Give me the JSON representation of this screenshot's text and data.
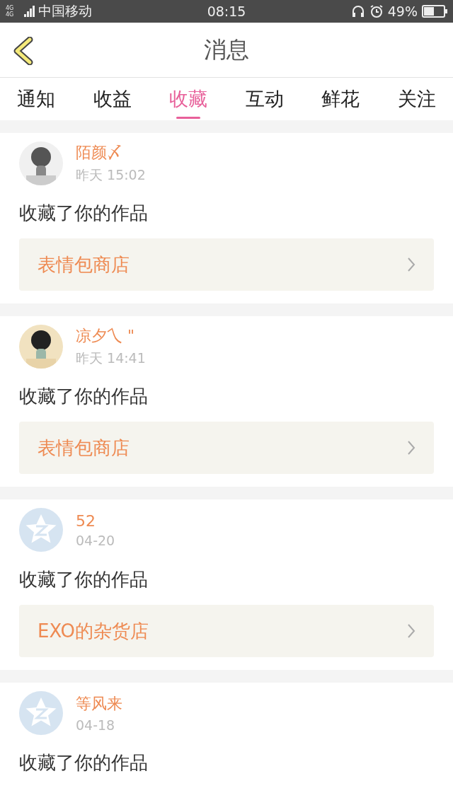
{
  "status_bar": {
    "network": "4G 4G",
    "carrier": "中国移动",
    "time": "08:15",
    "battery": "49%"
  },
  "header": {
    "title": "消息"
  },
  "tabs": [
    {
      "label": "通知",
      "selected": false
    },
    {
      "label": "收益",
      "selected": false
    },
    {
      "label": "收藏",
      "selected": true
    },
    {
      "label": "互动",
      "selected": false
    },
    {
      "label": "鲜花",
      "selected": false
    },
    {
      "label": "关注",
      "selected": false
    }
  ],
  "messages": [
    {
      "name": "陌颜〆",
      "time": "昨天 15:02",
      "text": "收藏了你的作品",
      "link": "表情包商店"
    },
    {
      "name": "凉夕乀 \"",
      "time": "昨天 14:41",
      "text": "收藏了你的作品",
      "link": "表情包商店"
    },
    {
      "avatar": {
        "kind": "default"
      },
      "name": "52",
      "time": "04-20",
      "text": "收藏了你的作品",
      "link": "EXO的杂货店"
    },
    {
      "avatar": {
        "kind": "default"
      },
      "name": "等风来",
      "time": "04-18",
      "text": "收藏了你的作品"
    }
  ]
}
